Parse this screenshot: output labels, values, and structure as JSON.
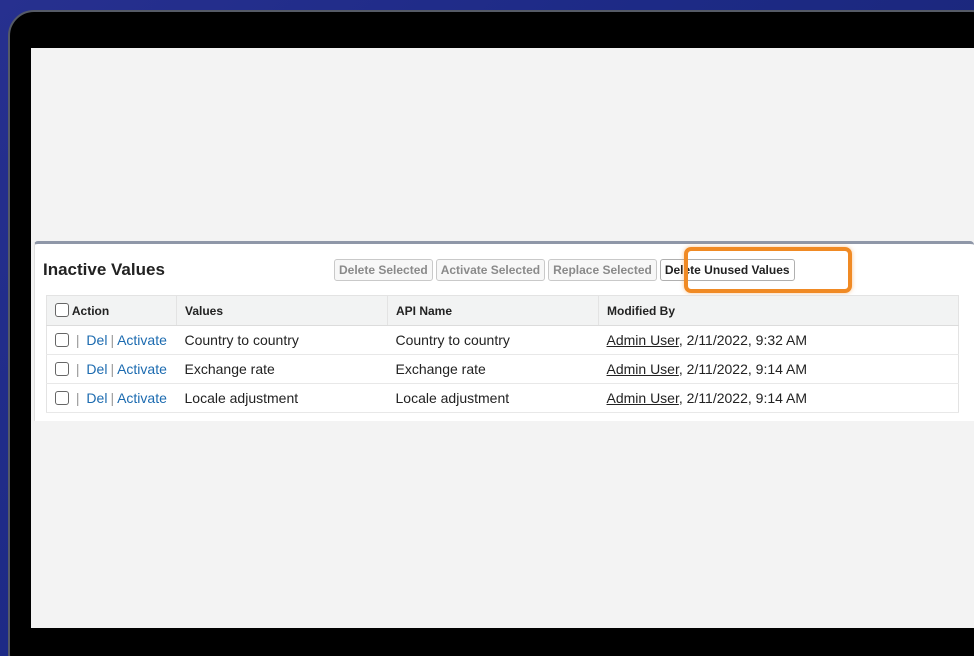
{
  "panel": {
    "title": "Inactive Values",
    "buttons": {
      "delete_selected": "Delete Selected",
      "activate_selected": "Activate Selected",
      "replace_selected": "Replace Selected",
      "delete_unused": "Delete Unused Values"
    }
  },
  "table": {
    "headers": {
      "action": "Action",
      "values": "Values",
      "api_name": "API Name",
      "modified_by": "Modified By"
    },
    "action_links": {
      "del": "Del",
      "activate": "Activate"
    },
    "rows": [
      {
        "value": "Country to country",
        "api_name": "Country to country",
        "user": "Admin User",
        "date": ", 2/11/2022, 9:32 AM"
      },
      {
        "value": "Exchange rate",
        "api_name": "Exchange rate",
        "user": "Admin User",
        "date": ", 2/11/2022, 9:14 AM"
      },
      {
        "value": "Locale adjustment",
        "api_name": "Locale adjustment",
        "user": "Admin User",
        "date": ", 2/11/2022, 9:14 AM"
      }
    ]
  },
  "colors": {
    "highlight": "#f08a24",
    "link": "#1c6bb0"
  }
}
